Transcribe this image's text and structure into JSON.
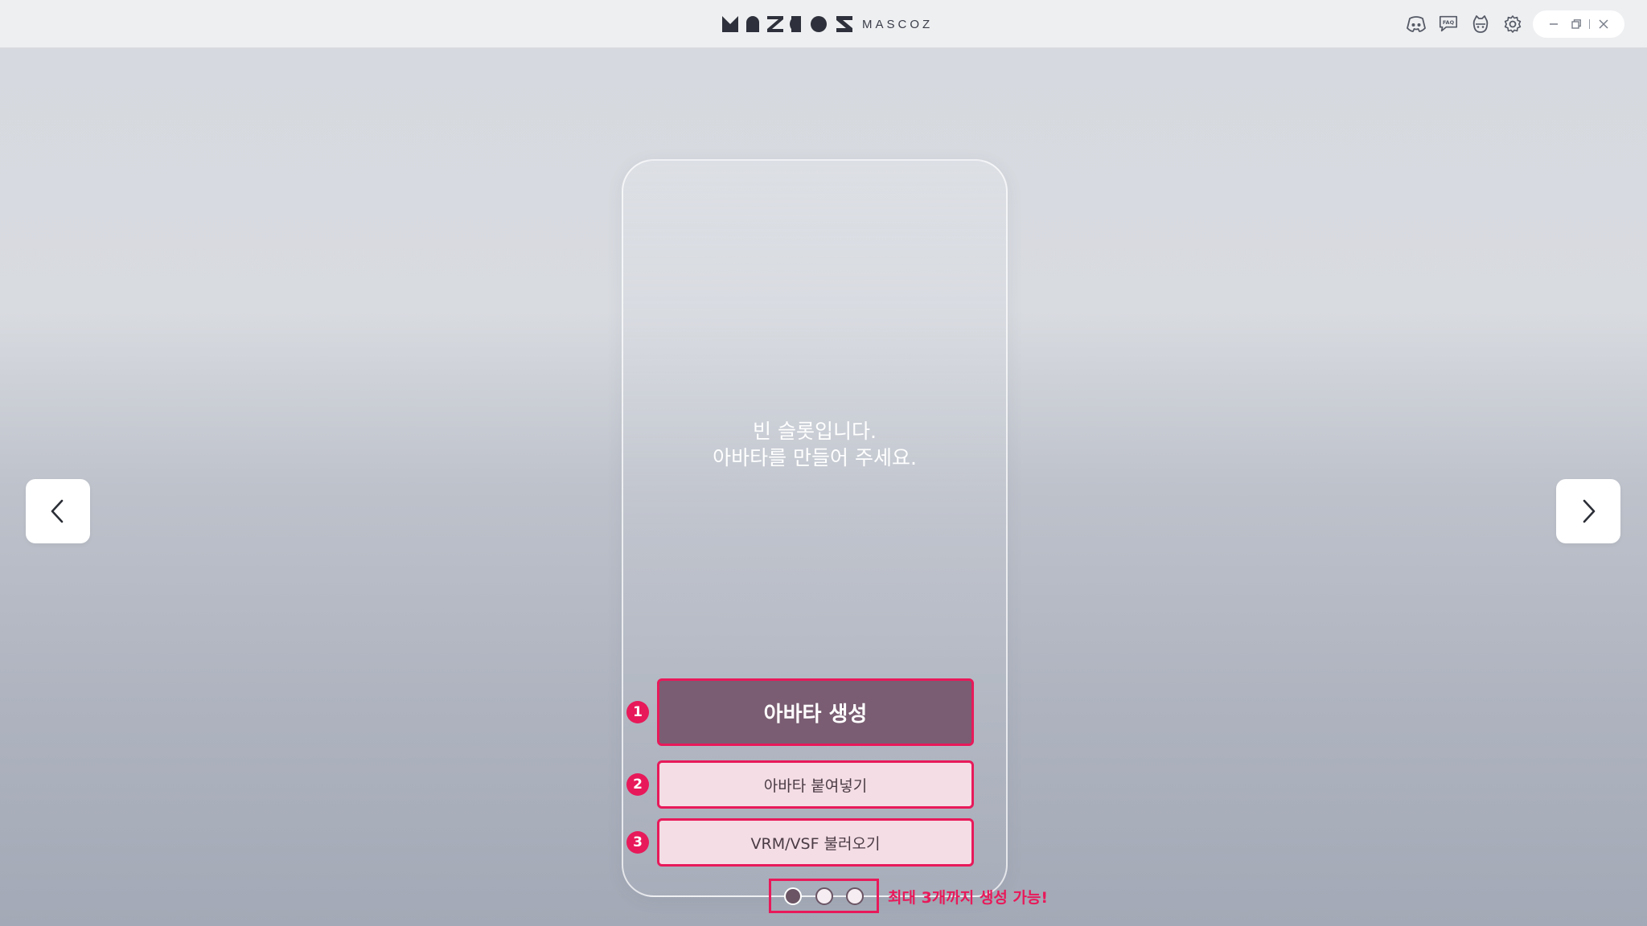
{
  "app": {
    "logo_text": "MASCOZ"
  },
  "header": {
    "icons": [
      "discord-icon",
      "faq-icon",
      "mascot-icon",
      "gear-icon"
    ],
    "faq_label": "FAQ"
  },
  "window_controls": [
    "minimize-icon",
    "restore-icon",
    "close-icon"
  ],
  "slot": {
    "empty_line1": "빈 슬롯입니다.",
    "empty_line2": "아바타를 만들어 주세요."
  },
  "actions": {
    "create": {
      "badge": "1",
      "label": "아바타 생성"
    },
    "paste": {
      "badge": "2",
      "label": "아바타 붙여넣기"
    },
    "import": {
      "badge": "3",
      "label": "VRM/VSF 불러오기"
    }
  },
  "pager": {
    "total": 3,
    "current": 1,
    "note": "최대 3개까지 생성 가능!"
  },
  "colors": {
    "accent": "#e8195a",
    "primary_button": "#7a5d72",
    "secondary_button": "#f4dde5"
  }
}
